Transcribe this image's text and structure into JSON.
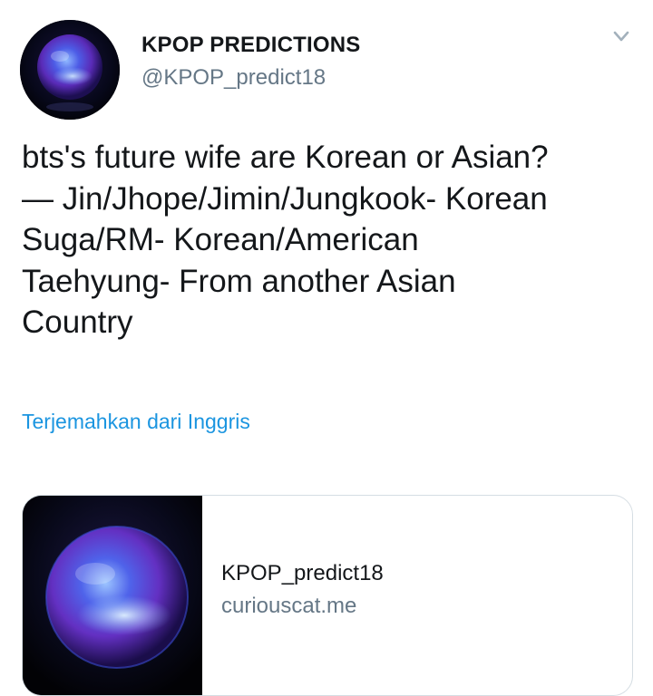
{
  "tweet": {
    "author": {
      "display_name": "KPOP PREDICTIONS",
      "handle": "@KPOP_predict18"
    },
    "menu_icon": "chevron-down-icon",
    "text_lines": [
      "bts's future wife are Korean or Asian?",
      "— Jin/Jhope/Jimin/Jungkook- Korean",
      "Suga/RM- Korean/American",
      "Taehyung- From another Asian",
      "Country"
    ],
    "translate_label": "Terjemahkan dari Inggris",
    "card": {
      "title": "KPOP_predict18",
      "domain": "curiouscat.me"
    }
  },
  "colors": {
    "text_primary": "#14171a",
    "text_secondary": "#657786",
    "link": "#1b95e0",
    "border": "#d5dde3"
  }
}
